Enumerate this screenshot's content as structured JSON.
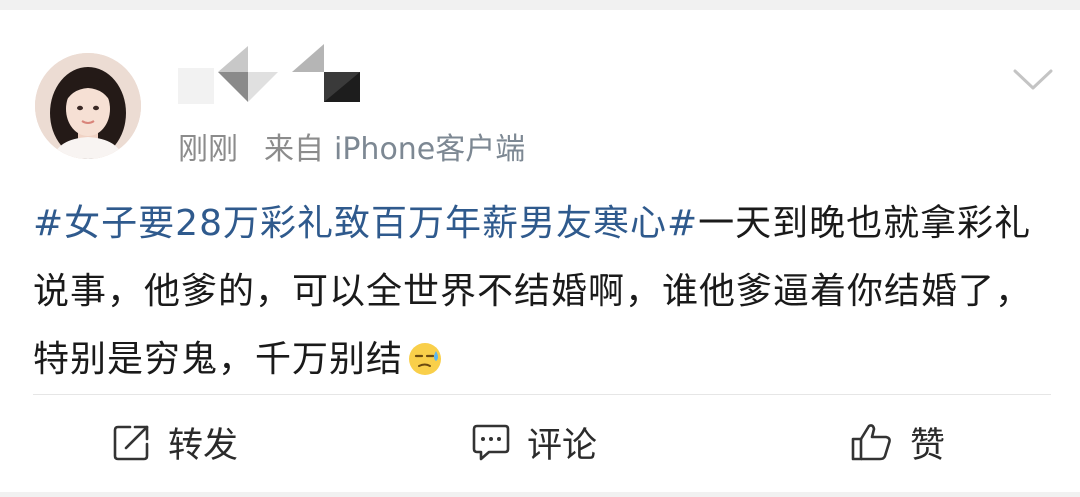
{
  "post": {
    "time": "刚刚",
    "source_prefix": "来自",
    "source_app": "iPhone客户端",
    "topic": "#女子要28万彩礼致百万年薪男友寒心#",
    "text": "一天到晚也就拿彩礼说事，他爹的，可以全世界不结婚啊，谁他爹逼着你结婚了，特别是穷鬼，千万别结",
    "emoji": "sweat-emoji"
  },
  "actions": {
    "repost_label": "转发",
    "comment_label": "评论",
    "like_label": "赞"
  },
  "icons": {
    "more": "chevron-down-icon",
    "repost": "share-arrow-icon",
    "comment": "comment-bubble-icon",
    "like": "thumbs-up-icon"
  },
  "colors": {
    "topic": "#2f5a8d",
    "meta_text": "#8c8c8c",
    "body_text": "#1a1a1a",
    "divider": "#e6e6e6",
    "background_gap": "#f1f1f1"
  }
}
